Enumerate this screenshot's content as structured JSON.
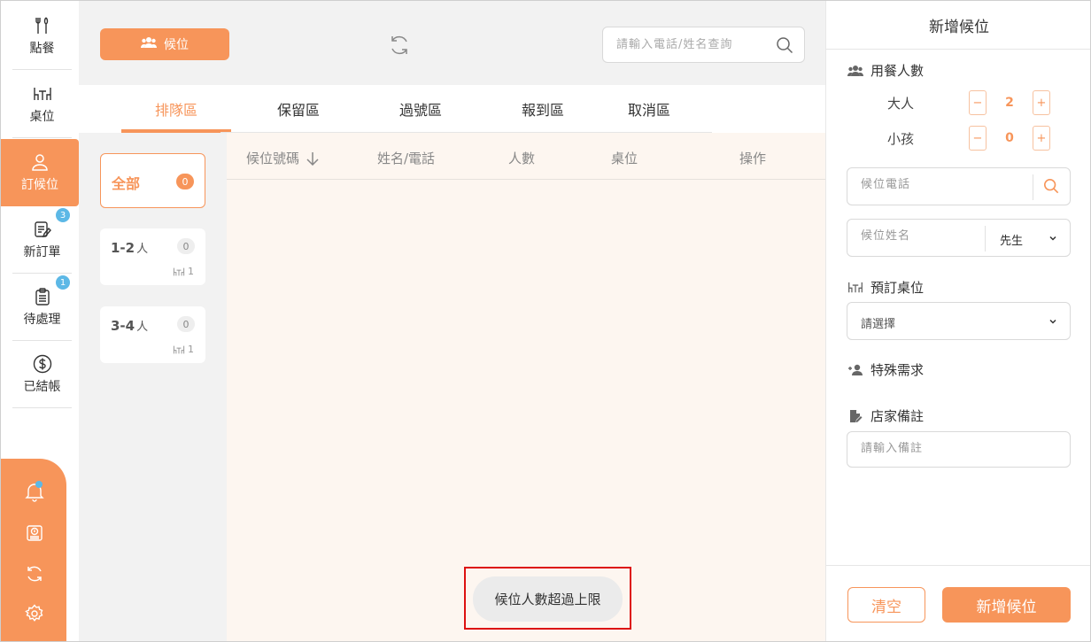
{
  "nav": {
    "items": [
      {
        "label": "點餐",
        "icon": "utensils-icon"
      },
      {
        "label": "桌位",
        "icon": "table-icon"
      },
      {
        "label": "訂候位",
        "icon": "person-icon"
      },
      {
        "label": "新訂單",
        "icon": "order-edit-icon",
        "badge": "3"
      },
      {
        "label": "待處理",
        "icon": "clipboard-icon",
        "badge": "1"
      },
      {
        "label": "已結帳",
        "icon": "dollar-icon"
      }
    ],
    "bottom_icons": [
      "bell-icon",
      "cashbox-icon",
      "sync-icon",
      "gear-icon"
    ]
  },
  "header": {
    "waitlist_button": "候位",
    "search_placeholder": "請輸入電話/姓名查詢"
  },
  "tabs": [
    "排隊區",
    "保留區",
    "過號區",
    "報到區",
    "取消區"
  ],
  "filters": [
    {
      "label": "全部",
      "count": "0"
    },
    {
      "label": "1-2",
      "unit": "人",
      "count": "0",
      "tables": "1"
    },
    {
      "label": "3-4",
      "unit": "人",
      "count": "0",
      "tables": "1"
    }
  ],
  "table": {
    "columns": [
      "候位號碼",
      "姓名/電話",
      "人數",
      "桌位",
      "操作"
    ]
  },
  "toast": "候位人數超過上限",
  "panel": {
    "title": "新增候位",
    "party_section": "用餐人數",
    "adults_label": "大人",
    "adults_value": "2",
    "children_label": "小孩",
    "children_value": "0",
    "phone_placeholder": "候位電話",
    "name_placeholder": "候位姓名",
    "title_select": "先生",
    "table_section": "預訂桌位",
    "table_select": "請選擇",
    "special_section": "特殊需求",
    "note_section": "店家備註",
    "note_placeholder": "請輸入備註",
    "clear_button": "清空",
    "add_button": "新增候位"
  },
  "colors": {
    "accent": "#f7955a",
    "badge": "#5cb8e6",
    "highlight": "#dd1111"
  }
}
